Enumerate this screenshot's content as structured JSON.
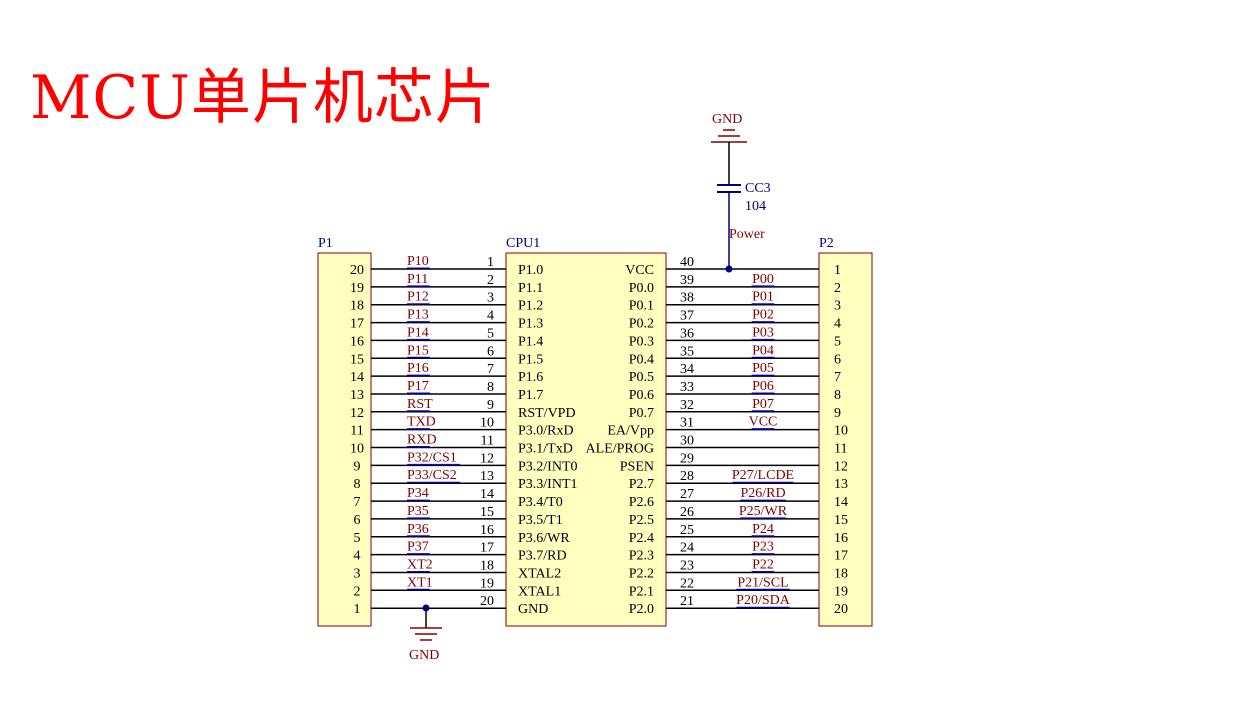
{
  "title": "MCU单片机芯片",
  "colors": {
    "title": "#ff0000",
    "component_body": "#ffffc0",
    "component_border": "#800000",
    "wire": "#000000",
    "net_label": "#800000",
    "net_underline": "#0000ff",
    "designator": "#000080",
    "power": "#800000",
    "junction": "#000080"
  },
  "power": {
    "gnd_top": "GND",
    "gnd_bottom": "GND",
    "power_label": "Power"
  },
  "capacitor": {
    "designator": "CC3",
    "value": "104"
  },
  "p1": {
    "designator": "P1",
    "pins": [
      "20",
      "19",
      "18",
      "17",
      "16",
      "15",
      "14",
      "13",
      "12",
      "11",
      "10",
      "9",
      "8",
      "7",
      "6",
      "5",
      "4",
      "3",
      "2",
      "1"
    ]
  },
  "p2": {
    "designator": "P2",
    "pins": [
      "1",
      "2",
      "3",
      "4",
      "5",
      "6",
      "7",
      "8",
      "9",
      "10",
      "11",
      "12",
      "13",
      "14",
      "15",
      "16",
      "17",
      "18",
      "19",
      "20"
    ]
  },
  "cpu": {
    "designator": "CPU1",
    "left_pins": [
      {
        "num": "1",
        "name": "P1.0",
        "net": "P10"
      },
      {
        "num": "2",
        "name": "P1.1",
        "net": "P11"
      },
      {
        "num": "3",
        "name": "P1.2",
        "net": "P12"
      },
      {
        "num": "4",
        "name": "P1.3",
        "net": "P13"
      },
      {
        "num": "5",
        "name": "P1.4",
        "net": "P14"
      },
      {
        "num": "6",
        "name": "P1.5",
        "net": "P15"
      },
      {
        "num": "7",
        "name": "P1.6",
        "net": "P16"
      },
      {
        "num": "8",
        "name": "P1.7",
        "net": "P17"
      },
      {
        "num": "9",
        "name": "RST/VPD",
        "net": "RST"
      },
      {
        "num": "10",
        "name": "P3.0/RxD",
        "net": "TXD"
      },
      {
        "num": "11",
        "name": "P3.1/TxD",
        "net": "RXD"
      },
      {
        "num": "12",
        "name": "P3.2/INT0",
        "net": "P32/CS1"
      },
      {
        "num": "13",
        "name": "P3.3/INT1",
        "net": "P33/CS2"
      },
      {
        "num": "14",
        "name": "P3.4/T0",
        "net": "P34"
      },
      {
        "num": "15",
        "name": "P3.5/T1",
        "net": "P35"
      },
      {
        "num": "16",
        "name": "P3.6/WR",
        "net": "P36"
      },
      {
        "num": "17",
        "name": "P3.7/RD",
        "net": "P37"
      },
      {
        "num": "18",
        "name": "XTAL2",
        "net": "XT2"
      },
      {
        "num": "19",
        "name": "XTAL1",
        "net": "XT1"
      },
      {
        "num": "20",
        "name": "GND",
        "net": ""
      }
    ],
    "right_pins": [
      {
        "num": "40",
        "name": "VCC",
        "net": ""
      },
      {
        "num": "39",
        "name": "P0.0",
        "net": "P00"
      },
      {
        "num": "38",
        "name": "P0.1",
        "net": "P01"
      },
      {
        "num": "37",
        "name": "P0.2",
        "net": "P02"
      },
      {
        "num": "36",
        "name": "P0.3",
        "net": "P03"
      },
      {
        "num": "35",
        "name": "P0.4",
        "net": "P04"
      },
      {
        "num": "34",
        "name": "P0.5",
        "net": "P05"
      },
      {
        "num": "33",
        "name": "P0.6",
        "net": "P06"
      },
      {
        "num": "32",
        "name": "P0.7",
        "net": "P07"
      },
      {
        "num": "31",
        "name": "EA/Vpp",
        "net": "VCC"
      },
      {
        "num": "30",
        "name": "ALE/PROG",
        "net": ""
      },
      {
        "num": "29",
        "name": "PSEN",
        "net": ""
      },
      {
        "num": "28",
        "name": "P2.7",
        "net": "P27/LCDE"
      },
      {
        "num": "27",
        "name": "P2.6",
        "net": "P26/RD"
      },
      {
        "num": "26",
        "name": "P2.5",
        "net": "P25/WR"
      },
      {
        "num": "25",
        "name": "P2.4",
        "net": "P24"
      },
      {
        "num": "24",
        "name": "P2.3",
        "net": "P23"
      },
      {
        "num": "23",
        "name": "P2.2",
        "net": "P22"
      },
      {
        "num": "22",
        "name": "P2.1",
        "net": "P21/SCL"
      },
      {
        "num": "21",
        "name": "P2.0",
        "net": "P20/SDA"
      }
    ]
  }
}
